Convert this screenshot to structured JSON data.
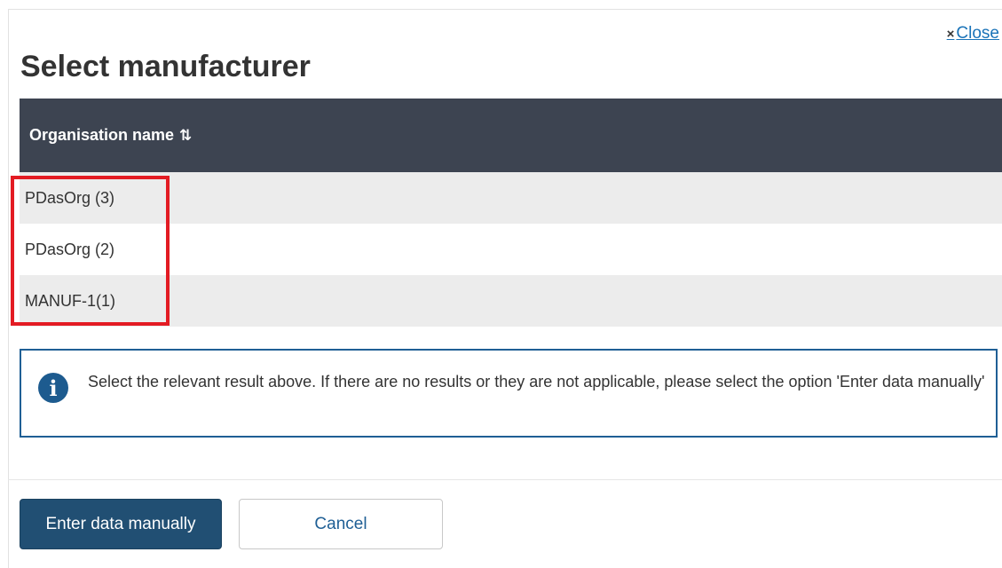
{
  "dialog": {
    "title": "Select manufacturer",
    "close_icon": "×",
    "close_label": "Close"
  },
  "table": {
    "column_header": "Organisation name",
    "sort_icon": "⇅",
    "rows": [
      {
        "name": "PDasOrg (3)"
      },
      {
        "name": "PDasOrg (2)"
      },
      {
        "name": "MANUF-1(1)"
      }
    ]
  },
  "info": {
    "icon": "i",
    "message": "Select the relevant result above. If there are no results or they are not applicable, please select the option 'Enter data manually'"
  },
  "footer": {
    "primary_label": "Enter data manually",
    "secondary_label": "Cancel"
  },
  "colors": {
    "header_bg": "#3d4451",
    "primary_button": "#214f73",
    "highlight": "#e31b23",
    "info_border": "#1f5f95"
  }
}
